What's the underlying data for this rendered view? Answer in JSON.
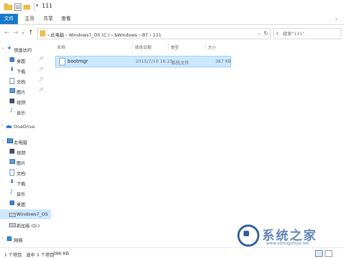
{
  "window": {
    "title": "111"
  },
  "ribbon": {
    "tabs": [
      "文件",
      "主页",
      "共享",
      "查看"
    ]
  },
  "address": {
    "path": "›  此电脑  ›  Windows7_OS (C:)  ›  $Windows.~BT  ›  111",
    "search_placeholder": "搜索\"111\""
  },
  "nav_pane": {
    "items": [
      {
        "label": "快速访问",
        "icon": "star-icon"
      },
      {
        "label": "桌面",
        "icon": "desktop-icon",
        "pinned": true
      },
      {
        "label": "下载",
        "icon": "download-icon",
        "pinned": true
      },
      {
        "label": "文档",
        "icon": "document-icon",
        "pinned": true
      },
      {
        "label": "图片",
        "icon": "picture-icon",
        "pinned": true
      },
      {
        "label": "视频",
        "icon": "video-icon"
      },
      {
        "label": "音乐",
        "icon": "music-icon"
      },
      {
        "label": "OneDrive",
        "icon": "cloud-icon"
      },
      {
        "label": "此电脑",
        "icon": "computer-icon"
      },
      {
        "label": "视频",
        "icon": "video-icon"
      },
      {
        "label": "图片",
        "icon": "picture-icon"
      },
      {
        "label": "文档",
        "icon": "document-icon"
      },
      {
        "label": "下载",
        "icon": "download-icon"
      },
      {
        "label": "音乐",
        "icon": "music-icon"
      },
      {
        "label": "桌面",
        "icon": "desktop-icon"
      },
      {
        "label": "Windows7_OS",
        "icon": "drive-icon",
        "selected": true
      },
      {
        "label": "新加卷 (D:)",
        "icon": "drive-icon"
      },
      {
        "label": "网络",
        "icon": "network-icon"
      }
    ]
  },
  "file_list": {
    "columns": [
      "名称",
      "修改日期",
      "类型",
      "大小"
    ],
    "rows": [
      {
        "name": "bootmgr",
        "modified": "2015/7/10 16:25",
        "type": "系统文件",
        "size": "387 KB"
      }
    ]
  },
  "status_bar": {
    "count": "1 个项目",
    "selected": "选中 1 个项目",
    "size": "386 KB"
  },
  "watermark": {
    "brand": "系统之家",
    "url": "www.xitongzhijia.net"
  },
  "colors": {
    "accent": "#1979ca",
    "selection": "#cce8ff",
    "folder": "#e9c04d"
  }
}
